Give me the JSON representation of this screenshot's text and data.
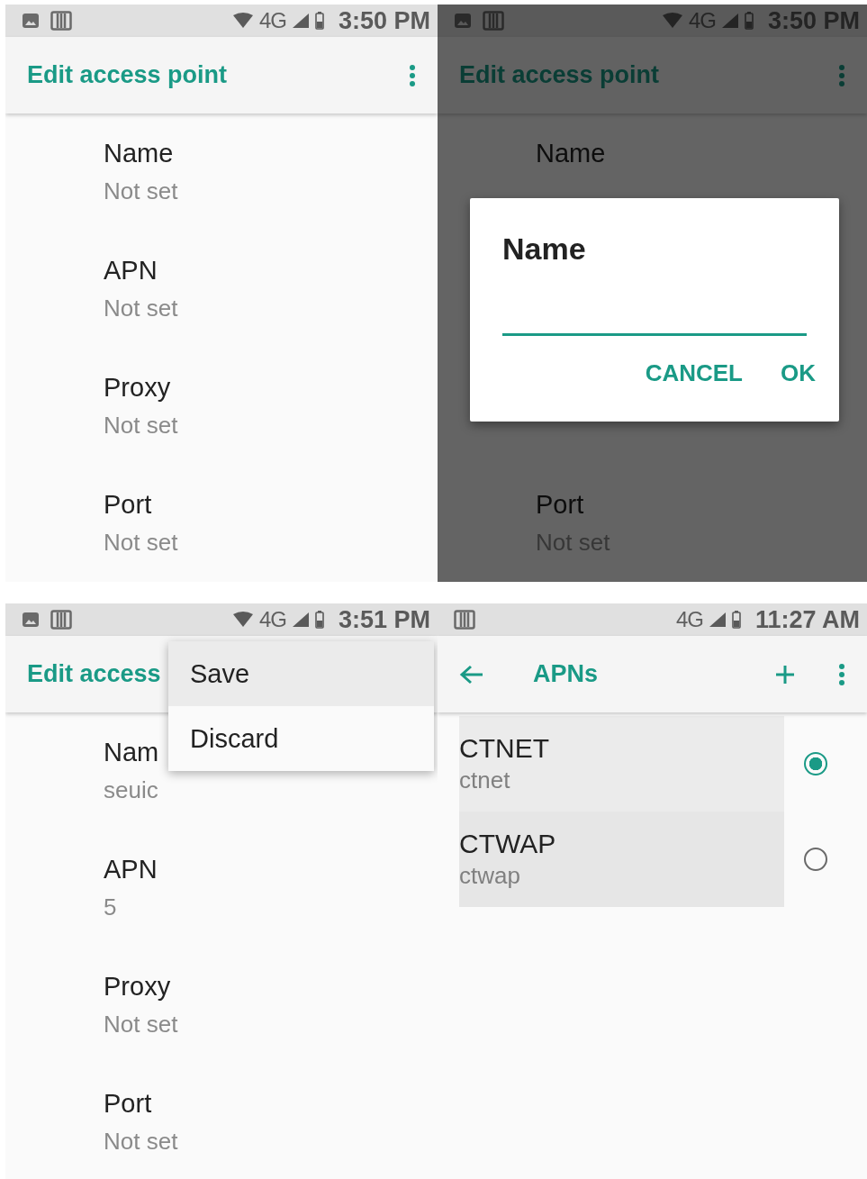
{
  "panels": [
    {
      "status_bar": {
        "icons": [
          {
            "kind": "image"
          },
          {
            "kind": "card"
          }
        ],
        "wifi": true,
        "network": "4G",
        "time": "3:50 PM"
      },
      "toolbar": {
        "back": false,
        "title": "Edit access point",
        "actions": [
          {
            "kind": "overflow"
          }
        ]
      },
      "dimmed": false,
      "fields": [
        {
          "label": "Name",
          "value": "Not set"
        },
        {
          "label": "APN",
          "value": "Not set"
        },
        {
          "label": "Proxy",
          "value": "Not set"
        },
        {
          "label": "Port",
          "value": "Not set"
        }
      ]
    },
    {
      "status_bar": {
        "icons": [
          {
            "kind": "image"
          },
          {
            "kind": "card"
          }
        ],
        "wifi": true,
        "network": "4G",
        "time": "3:50 PM"
      },
      "toolbar": {
        "back": false,
        "title": "Edit access point",
        "actions": [
          {
            "kind": "overflow"
          }
        ]
      },
      "dimmed": true,
      "fields": [
        {
          "label": "Name"
        },
        {
          "label": "Port",
          "value": "Not set"
        }
      ],
      "dialog": {
        "title": "Name",
        "buttons": [
          "CANCEL",
          "OK"
        ]
      }
    },
    {
      "status_bar": {
        "icons": [
          {
            "kind": "image"
          },
          {
            "kind": "card"
          }
        ],
        "wifi": true,
        "network": "4G",
        "time": "3:51 PM"
      },
      "toolbar": {
        "back": false,
        "title": "Edit access"
      },
      "dimmed": false,
      "fields": [
        {
          "label": "Nam",
          "value": "seuic"
        },
        {
          "label": "APN",
          "value": "5"
        },
        {
          "label": "Proxy",
          "value": "Not set"
        },
        {
          "label": "Port",
          "value": "Not set"
        }
      ],
      "menu": [
        {
          "label": "Save",
          "selected": true
        },
        {
          "label": "Discard",
          "selected": false
        }
      ]
    },
    {
      "status_bar": {
        "icons": [
          {
            "kind": "card"
          }
        ],
        "wifi": false,
        "network": "4G",
        "time": "11:27 AM"
      },
      "toolbar": {
        "back": true,
        "title": "APNs",
        "actions": [
          {
            "kind": "add"
          },
          {
            "kind": "overflow"
          }
        ]
      },
      "dimmed": false,
      "apns": [
        {
          "name": "CTNET",
          "apn": "ctnet",
          "selected": true
        },
        {
          "name": "CTWAP",
          "apn": "ctwap",
          "selected": false
        }
      ]
    }
  ]
}
